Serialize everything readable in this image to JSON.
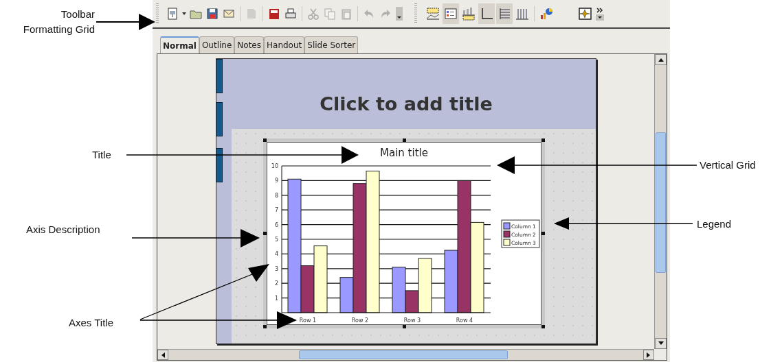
{
  "annotations": [
    {
      "label": "Toolbar Formatting Grid"
    },
    {
      "label": "Title"
    },
    {
      "label": "Vertical Grid"
    },
    {
      "label": "Legend"
    },
    {
      "label": "Axis Description"
    },
    {
      "label": "Axes Title"
    }
  ],
  "toolbar": {
    "buttons": [
      {
        "disabled": false,
        "pressed": false
      },
      {
        "disabled": false,
        "pressed": false
      },
      {
        "disabled": false,
        "pressed": false
      },
      {
        "disabled": false,
        "pressed": false
      },
      {
        "disabled": false,
        "pressed": false
      },
      {
        "disabled": true,
        "pressed": false
      },
      {
        "disabled": false,
        "pressed": false
      },
      {
        "disabled": false,
        "pressed": false
      },
      {
        "disabled": true,
        "pressed": false
      },
      {
        "disabled": true,
        "pressed": false
      },
      {
        "disabled": true,
        "pressed": false
      },
      {
        "disabled": true,
        "pressed": false
      },
      {
        "disabled": true,
        "pressed": false
      },
      {
        "disabled": false,
        "pressed": false
      },
      {
        "disabled": false,
        "pressed": false
      },
      {
        "disabled": false,
        "pressed": true
      },
      {
        "disabled": false,
        "pressed": false
      },
      {
        "disabled": false,
        "pressed": true
      },
      {
        "disabled": false,
        "pressed": true
      },
      {
        "disabled": false,
        "pressed": false
      },
      {
        "disabled": false,
        "pressed": false
      },
      {
        "disabled": false,
        "pressed": false
      },
      {
        "disabled": false,
        "pressed": false
      }
    ]
  },
  "tabs": [
    {
      "label": "Normal",
      "selected": true
    },
    {
      "label": "Outline",
      "selected": false
    },
    {
      "label": "Notes",
      "selected": false
    },
    {
      "label": "Handout",
      "selected": false
    },
    {
      "label": "Slide Sorter",
      "selected": false
    }
  ],
  "slide": {
    "title_placeholder": "Click to add title",
    "chart_data": {
      "type": "bar",
      "title": "Main title",
      "categories": [
        "Row 1",
        "Row 2",
        "Row 3",
        "Row 4"
      ],
      "grid": "horizontal",
      "legend": "right",
      "ylim": [
        0,
        10
      ],
      "yticks": [
        1,
        2,
        3,
        4,
        5,
        6,
        7,
        8,
        9,
        10
      ],
      "series": [
        {
          "name": "Column 1",
          "color": "#9999ff",
          "values": [
            9.1,
            2.4,
            3.1,
            4.25
          ]
        },
        {
          "name": "Column 2",
          "color": "#993366",
          "values": [
            3.2,
            8.8,
            1.5,
            9.0
          ]
        },
        {
          "name": "Column 3",
          "color": "#ffffcc",
          "values": [
            4.55,
            9.65,
            3.7,
            6.15
          ]
        }
      ]
    }
  }
}
